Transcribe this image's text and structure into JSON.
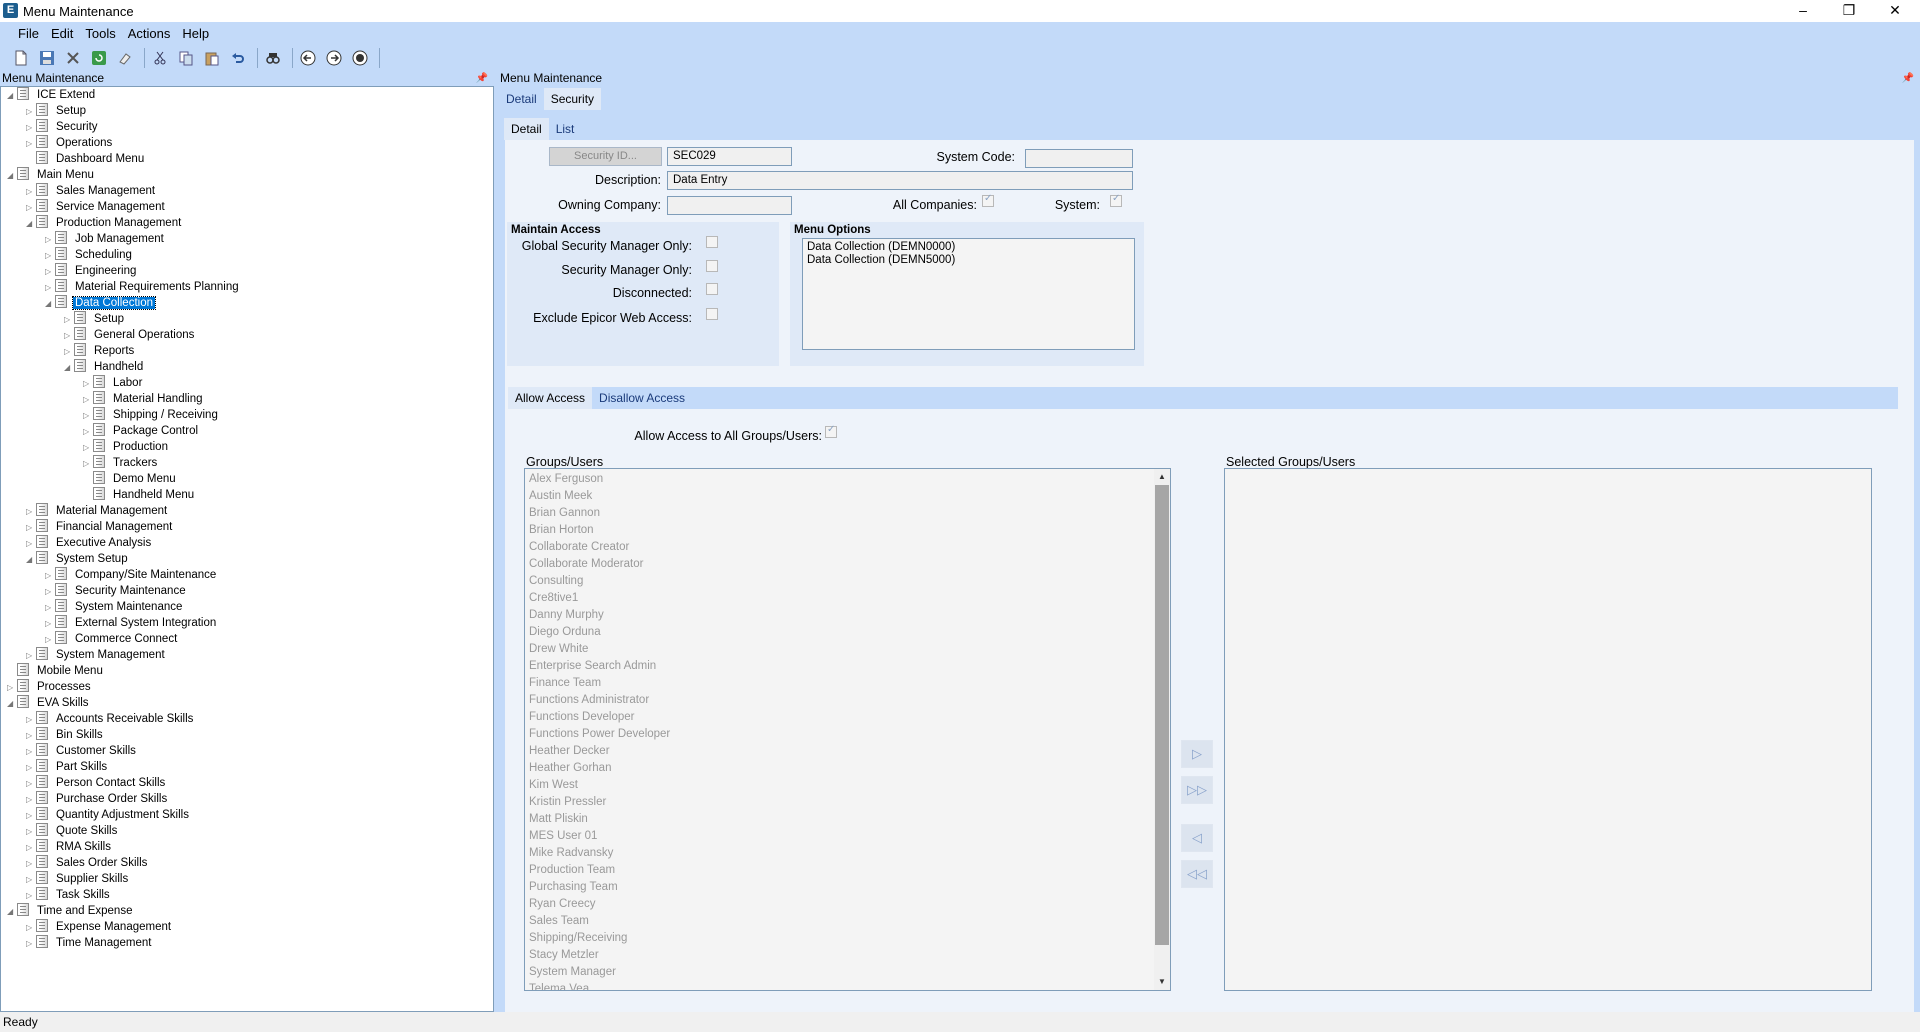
{
  "window": {
    "title": "Menu Maintenance",
    "app_icon": "E"
  },
  "menubar": [
    "File",
    "Edit",
    "Tools",
    "Actions",
    "Help"
  ],
  "left_pane": {
    "header": "Menu Maintenance"
  },
  "tree": [
    {
      "label": "ICE Extend",
      "level": 0,
      "exp": "open"
    },
    {
      "label": "Setup",
      "level": 1,
      "exp": "closed"
    },
    {
      "label": "Security",
      "level": 1,
      "exp": "closed"
    },
    {
      "label": "Operations",
      "level": 1,
      "exp": "closed"
    },
    {
      "label": "Dashboard Menu",
      "level": 1,
      "exp": "none"
    },
    {
      "label": "Main Menu",
      "level": 0,
      "exp": "open"
    },
    {
      "label": "Sales Management",
      "level": 1,
      "exp": "closed"
    },
    {
      "label": "Service Management",
      "level": 1,
      "exp": "closed"
    },
    {
      "label": "Production Management",
      "level": 1,
      "exp": "open"
    },
    {
      "label": "Job Management",
      "level": 2,
      "exp": "closed"
    },
    {
      "label": "Scheduling",
      "level": 2,
      "exp": "closed"
    },
    {
      "label": "Engineering",
      "level": 2,
      "exp": "closed"
    },
    {
      "label": "Material Requirements Planning",
      "level": 2,
      "exp": "closed"
    },
    {
      "label": "Data Collection",
      "level": 2,
      "exp": "open",
      "selected": true
    },
    {
      "label": "Setup",
      "level": 3,
      "exp": "closed"
    },
    {
      "label": "General Operations",
      "level": 3,
      "exp": "closed"
    },
    {
      "label": "Reports",
      "level": 3,
      "exp": "closed"
    },
    {
      "label": "Handheld",
      "level": 3,
      "exp": "open"
    },
    {
      "label": "Labor",
      "level": 4,
      "exp": "closed"
    },
    {
      "label": "Material Handling",
      "level": 4,
      "exp": "closed"
    },
    {
      "label": "Shipping / Receiving",
      "level": 4,
      "exp": "closed"
    },
    {
      "label": "Package Control",
      "level": 4,
      "exp": "closed"
    },
    {
      "label": "Production",
      "level": 4,
      "exp": "closed"
    },
    {
      "label": "Trackers",
      "level": 4,
      "exp": "closed"
    },
    {
      "label": "Demo Menu",
      "level": 4,
      "exp": "none"
    },
    {
      "label": "Handheld Menu",
      "level": 4,
      "exp": "none"
    },
    {
      "label": "Material Management",
      "level": 1,
      "exp": "closed"
    },
    {
      "label": "Financial Management",
      "level": 1,
      "exp": "closed"
    },
    {
      "label": "Executive Analysis",
      "level": 1,
      "exp": "closed"
    },
    {
      "label": "System Setup",
      "level": 1,
      "exp": "open"
    },
    {
      "label": "Company/Site Maintenance",
      "level": 2,
      "exp": "closed"
    },
    {
      "label": "Security Maintenance",
      "level": 2,
      "exp": "closed"
    },
    {
      "label": "System Maintenance",
      "level": 2,
      "exp": "closed"
    },
    {
      "label": "External System Integration",
      "level": 2,
      "exp": "closed"
    },
    {
      "label": "Commerce Connect",
      "level": 2,
      "exp": "closed"
    },
    {
      "label": "System Management",
      "level": 1,
      "exp": "closed"
    },
    {
      "label": "Mobile Menu",
      "level": 0,
      "exp": "none"
    },
    {
      "label": "Processes",
      "level": 0,
      "exp": "closed"
    },
    {
      "label": "EVA Skills",
      "level": 0,
      "exp": "open"
    },
    {
      "label": "Accounts Receivable Skills",
      "level": 1,
      "exp": "closed"
    },
    {
      "label": "Bin Skills",
      "level": 1,
      "exp": "closed"
    },
    {
      "label": "Customer Skills",
      "level": 1,
      "exp": "closed"
    },
    {
      "label": "Part Skills",
      "level": 1,
      "exp": "closed"
    },
    {
      "label": "Person Contact Skills",
      "level": 1,
      "exp": "closed"
    },
    {
      "label": "Purchase Order Skills",
      "level": 1,
      "exp": "closed"
    },
    {
      "label": "Quantity Adjustment Skills",
      "level": 1,
      "exp": "closed"
    },
    {
      "label": "Quote Skills",
      "level": 1,
      "exp": "closed"
    },
    {
      "label": "RMA Skills",
      "level": 1,
      "exp": "closed"
    },
    {
      "label": "Sales Order Skills",
      "level": 1,
      "exp": "closed"
    },
    {
      "label": "Supplier Skills",
      "level": 1,
      "exp": "closed"
    },
    {
      "label": "Task Skills",
      "level": 1,
      "exp": "closed"
    },
    {
      "label": "Time and Expense",
      "level": 0,
      "exp": "open"
    },
    {
      "label": "Expense Management",
      "level": 1,
      "exp": "closed"
    },
    {
      "label": "Time Management",
      "level": 1,
      "exp": "closed"
    }
  ],
  "right_pane": {
    "header": "Menu Maintenance",
    "top_tabs": [
      "Detail",
      "Security"
    ],
    "sub_tabs": [
      "Detail",
      "List"
    ],
    "security_id_button": "Security ID...",
    "security_id_value": "SEC029",
    "system_code_label": "System Code:",
    "system_code_value": "",
    "description_label": "Description:",
    "description_value": "Data Entry",
    "owning_company_label": "Owning Company:",
    "owning_company_value": "",
    "all_companies_label": "All Companies:",
    "system_label": "System:"
  },
  "maintain_access": {
    "title": "Maintain Access",
    "global_security_manager_only": "Global Security Manager Only:",
    "security_manager_only": "Security Manager Only:",
    "disconnected": "Disconnected:",
    "exclude_epicor_web_access": "Exclude Epicor Web Access:"
  },
  "menu_options": {
    "title": "Menu Options",
    "items": [
      "Data Collection (DEMN0000)",
      "Data Collection (DEMN5000)"
    ]
  },
  "access_tabs": [
    "Allow Access",
    "Disallow Access"
  ],
  "allow_all_label": "Allow Access to All Groups/Users:",
  "groups_users": {
    "title": "Groups/Users",
    "items": [
      "Alex Ferguson",
      "Austin Meek",
      "Brian Gannon",
      "Brian Horton",
      "Collaborate Creator",
      "Collaborate Moderator",
      "Consulting",
      "Cre8tive1",
      "Danny Murphy",
      "Diego Orduna",
      "Drew White",
      "Enterprise Search Admin",
      "Finance Team",
      "Functions Administrator",
      "Functions Developer",
      "Functions Power Developer",
      "Heather Decker",
      "Heather Gorhan",
      "Kim West",
      "Kristin Pressler",
      "Matt Pliskin",
      "MES User 01",
      "Mike Radvansky",
      "Production Team",
      "Purchasing Team",
      "Ryan Creecy",
      "Sales Team",
      "Shipping/Receiving",
      "Stacy Metzler",
      "System Manager",
      "Telema Vea"
    ]
  },
  "selected_groups_users": {
    "title": "Selected Groups/Users",
    "items": []
  },
  "status": "Ready"
}
